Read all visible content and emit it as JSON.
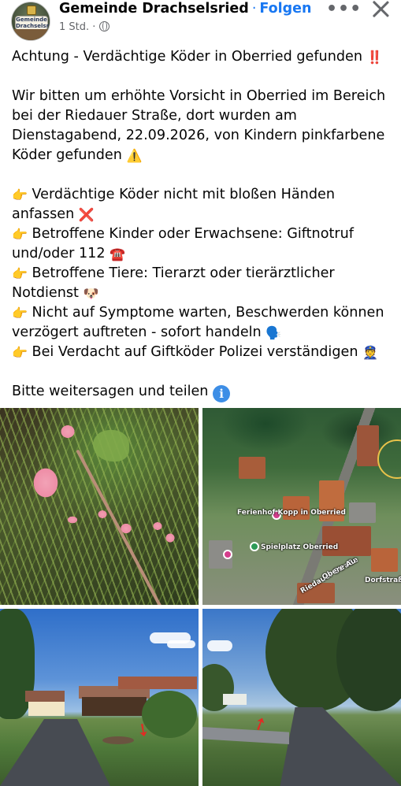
{
  "header": {
    "avatar_text": "Gemeinde Drachselsried",
    "page_name": "Gemeinde Drachselsried",
    "separator": "·",
    "follow_label": "Folgen",
    "timestamp": "1 Std. ·",
    "privacy_icon": "globe-icon",
    "more_label": "•••",
    "close_icon": "close-icon"
  },
  "post": {
    "title": "Achtung - Verdächtige Köder in Oberried gefunden",
    "title_emoji": "‼️",
    "intro": "Wir bitten um erhöhte Vorsicht in Oberried im Bereich bei der Riedauer Straße, dort wurden am Dienstagabend, 22.09.2026, von Kindern pinkfarbene Köder gefunden",
    "intro_emoji": "⚠️",
    "bullet_emoji": "👉",
    "bullets": [
      {
        "text": "Verdächtige Köder nicht mit bloßen Händen anfassen",
        "emoji": "❌"
      },
      {
        "text": "Betroffene Kinder oder Erwachsene: Giftnotruf und/oder 112",
        "emoji": "☎️"
      },
      {
        "text": "Betroffene Tiere: Tierarzt oder tierärztlicher Notdienst",
        "emoji": "🐶"
      },
      {
        "text": "Nicht auf Symptome warten, Beschwerden können verzögert auftreten - sofort handeln",
        "emoji": "🗣️"
      },
      {
        "text": "Bei Verdacht auf Giftköder Polizei verständigen",
        "emoji": "👮"
      }
    ],
    "closing": "Bitte weitersagen und teilen",
    "closing_icon": "i"
  },
  "photos": {
    "map_labels": {
      "pension": "Ferienhof Kopp in Oberried",
      "playground": "Spielplatz Oberried",
      "street_a": "Riedauer Straße",
      "street_b": "Obere Au",
      "street_c": "Dorfstraße"
    }
  }
}
